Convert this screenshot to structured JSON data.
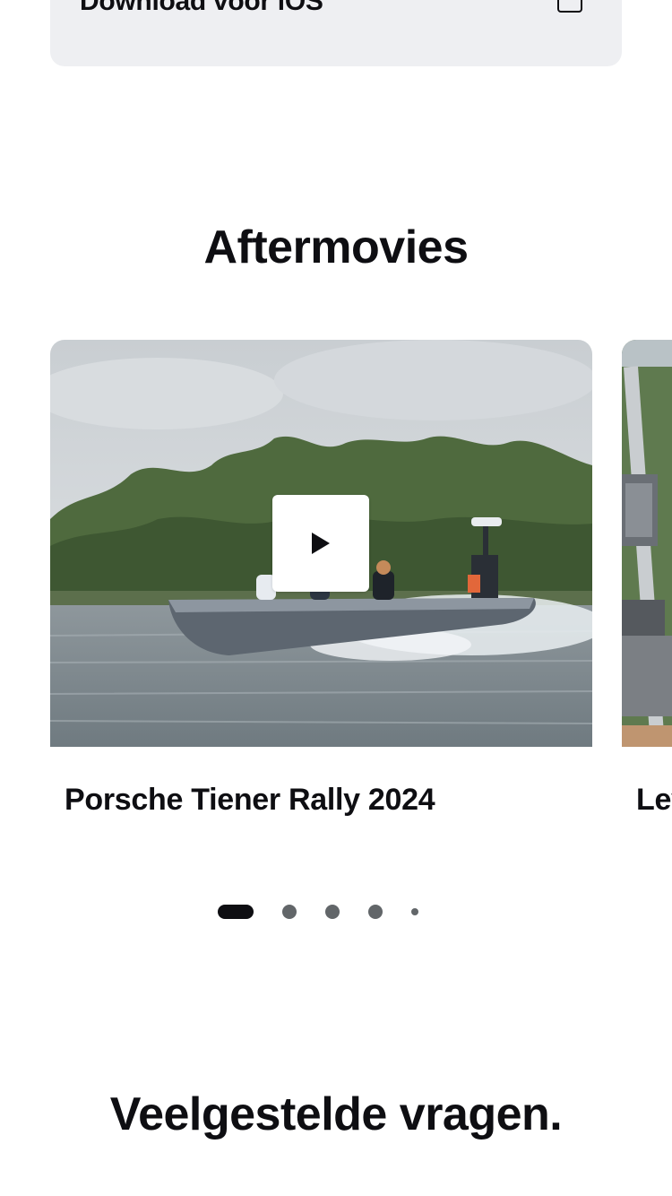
{
  "download": {
    "label": "Download voor iOS",
    "icon": "external-link-icon"
  },
  "aftermovies": {
    "title": "Aftermovies",
    "slides": [
      {
        "caption": "Porsche Tiener Rally 2024",
        "media": "video-thumbnail-speedboat",
        "play_icon": "play-icon"
      },
      {
        "caption": "Lev",
        "media": "video-thumbnail-aerial-town"
      }
    ],
    "pagination": {
      "total_visible": 5,
      "active_index": 0
    }
  },
  "faq": {
    "title": "Veelgestelde vragen."
  },
  "colors": {
    "text": "#0e0e12",
    "card_background": "#eeeff2",
    "dot_inactive": "#626669",
    "dot_active": "#0e0e12"
  }
}
